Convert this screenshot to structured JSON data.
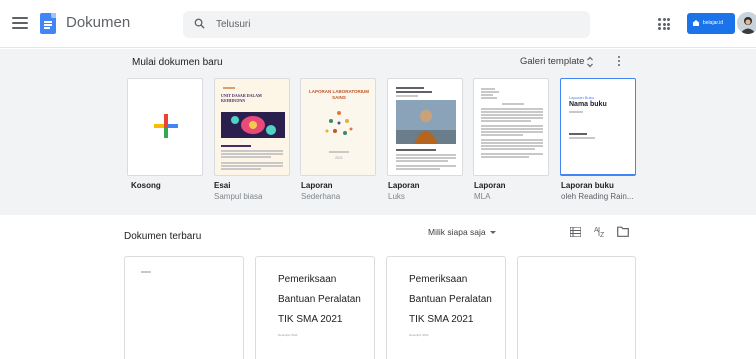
{
  "header": {
    "app_title": "Dokumen",
    "search_placeholder": "Telusuri",
    "account_label": "belajar.id"
  },
  "templates": {
    "section_title": "Mulai dokumen baru",
    "gallery_label": "Galeri template",
    "items": [
      {
        "name": "Kosong",
        "subtitle": ""
      },
      {
        "name": "Esai",
        "subtitle": "Sampul biasa"
      },
      {
        "name": "Laporan",
        "subtitle": "Sederhana"
      },
      {
        "name": "Laporan",
        "subtitle": "Luks"
      },
      {
        "name": "Laporan",
        "subtitle": "MLA"
      },
      {
        "name": "Laporan buku",
        "subtitle": "oleh Reading Rain..."
      }
    ],
    "thumb": {
      "essay_title": "UNIT DASAR DALAM KEHIDUPAN",
      "lab_title": "LAPORAN LABORATORIUM SAINS",
      "lab_year": "2021",
      "book_label": "Laporan Buku",
      "book_title": "Nama buku"
    }
  },
  "recent": {
    "section_title": "Dokumen terbaru",
    "owner_filter": "Milik siapa saja",
    "docs": [
      {
        "title_lines": [],
        "meta": ""
      },
      {
        "title_lines": [
          "Pemeriksaan",
          "Bantuan Peralatan",
          "TIK SMA 2021"
        ],
        "meta": "Deskripsi SMA"
      },
      {
        "title_lines": [
          "Pemeriksaan",
          "Bantuan Peralatan",
          "TIK SMA 2021"
        ],
        "meta": "Deskripsi SMA"
      },
      {
        "title_lines": [],
        "meta": ""
      }
    ]
  },
  "colors": {
    "brand_blue": "#4285f4",
    "account_blue": "#1a73e8",
    "template_bg": "#f1f3f4",
    "plus_red": "#ea4335",
    "plus_yellow": "#fbbc04",
    "plus_green": "#34a853",
    "plus_blue": "#4285f4"
  }
}
